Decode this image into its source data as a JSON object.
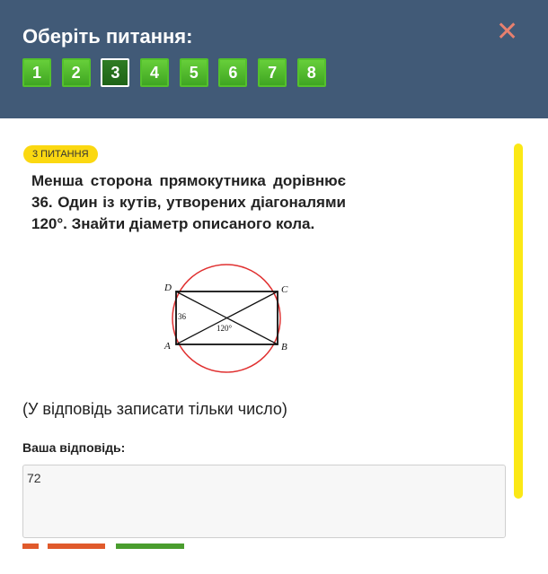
{
  "header": {
    "title": "Оберіть питання:",
    "close_icon": "close-icon",
    "questions": [
      "1",
      "2",
      "3",
      "4",
      "5",
      "6",
      "7",
      "8"
    ],
    "active_question": "3"
  },
  "question": {
    "badge": "3 ПИТАННЯ",
    "text": "Менша сторона прямокутника дорівнює 36. Один із кутів, утворених діагоналями 120°. Знайти діаметр описаного кола.",
    "figure": {
      "vertex_a": "A",
      "vertex_b": "B",
      "vertex_c": "C",
      "vertex_d": "D",
      "side_label": "36",
      "angle_label": "120°"
    },
    "hint": "(У відповідь записати тільки число)"
  },
  "answer": {
    "label": "Ваша відповідь:",
    "value": "72"
  },
  "colors": {
    "header_bg": "#415a77",
    "button_green": "#4fb92a",
    "active_button": "#2a7320",
    "badge_yellow": "#fbd811",
    "scrollbar_yellow": "#fbe816",
    "circle_red": "#e03030",
    "close_color": "#e8806e"
  }
}
